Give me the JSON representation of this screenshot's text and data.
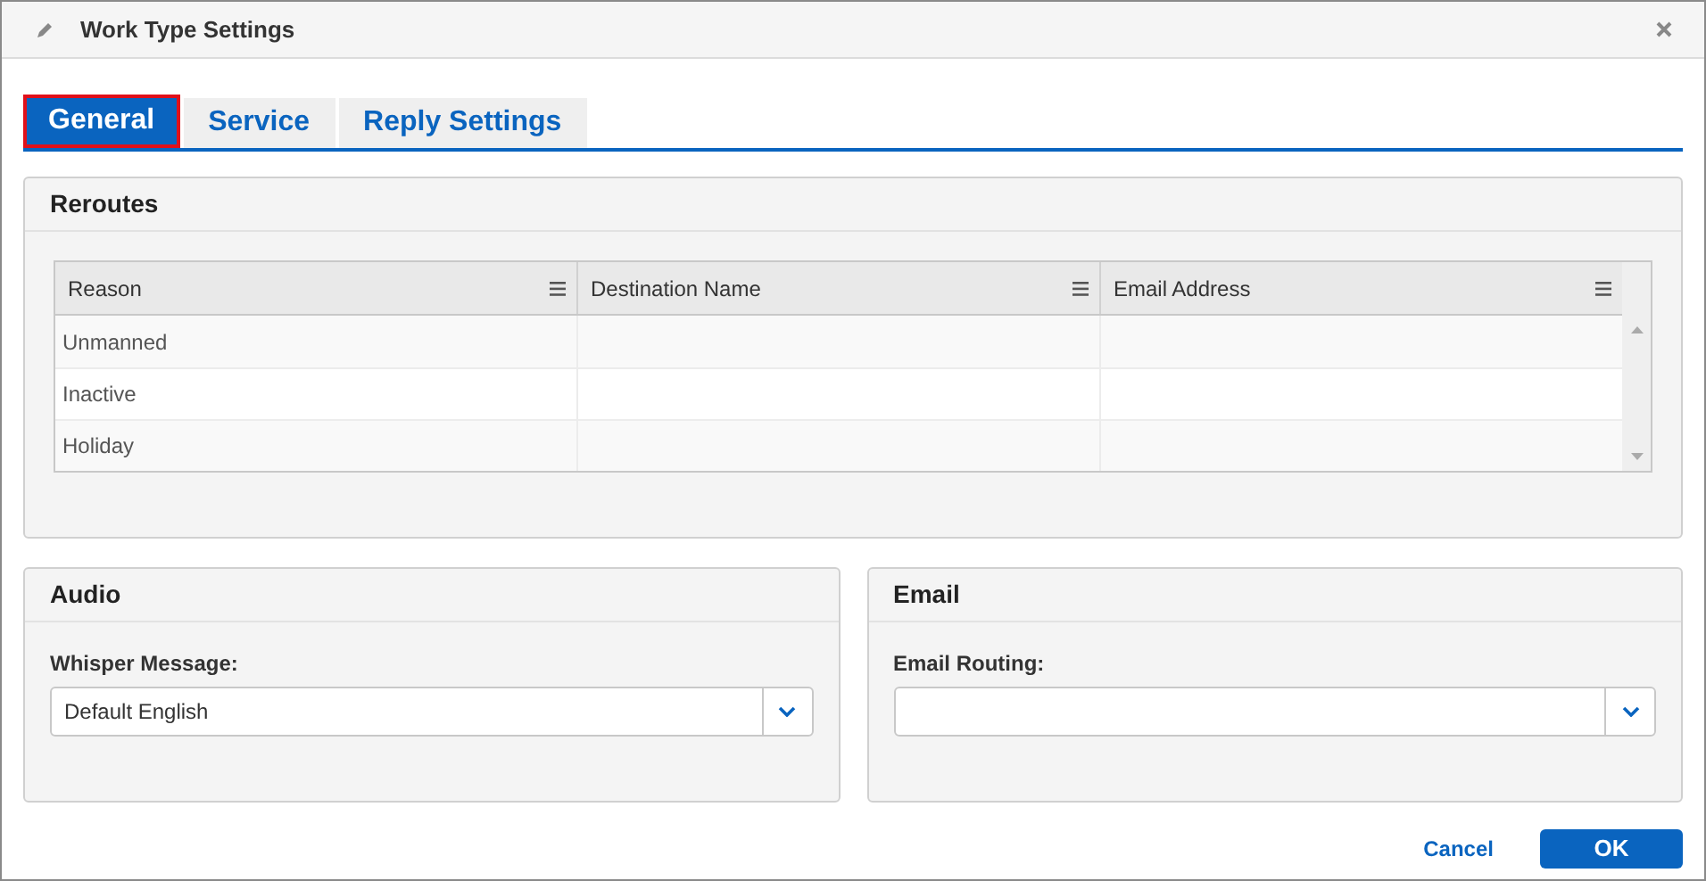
{
  "window": {
    "title": "Work Type Settings"
  },
  "tabs": [
    {
      "label": "General",
      "selected": true
    },
    {
      "label": "Service",
      "selected": false
    },
    {
      "label": "Reply Settings",
      "selected": false
    }
  ],
  "reroutes": {
    "title": "Reroutes",
    "columns": [
      "Reason",
      "Destination Name",
      "Email Address"
    ],
    "rows": [
      [
        "Unmanned",
        "",
        ""
      ],
      [
        "Inactive",
        "",
        ""
      ],
      [
        "Holiday",
        "",
        ""
      ]
    ]
  },
  "audio": {
    "title": "Audio",
    "label": "Whisper Message:",
    "value": "Default English"
  },
  "email": {
    "title": "Email",
    "label": "Email Routing:"
  },
  "buttons": {
    "cancel": "Cancel",
    "ok": "OK"
  }
}
